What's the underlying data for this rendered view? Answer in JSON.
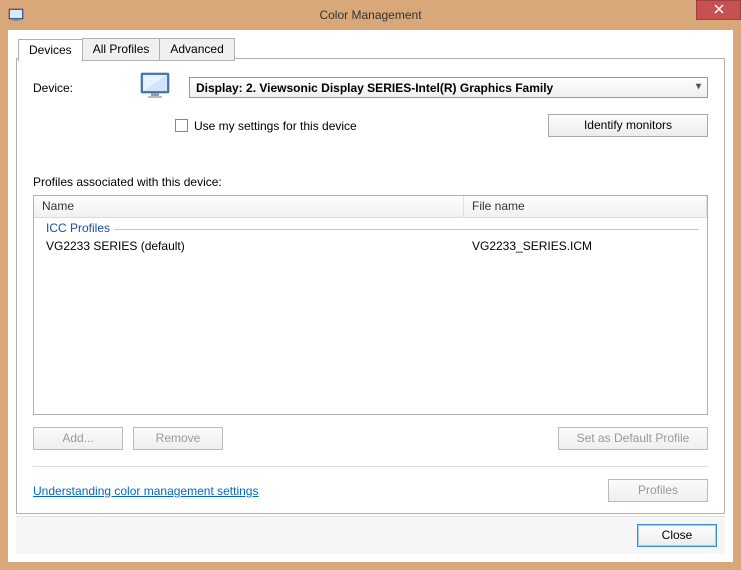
{
  "window": {
    "title": "Color Management"
  },
  "tabs": [
    {
      "label": "Devices",
      "active": true
    },
    {
      "label": "All Profiles",
      "active": false
    },
    {
      "label": "Advanced",
      "active": false
    }
  ],
  "device": {
    "label": "Device:",
    "selected": "Display: 2. Viewsonic Display SERIES-Intel(R) Graphics Family"
  },
  "use_my_settings": {
    "label": "Use my settings for this device",
    "checked": false
  },
  "identify_btn": "Identify monitors",
  "profiles_section_label": "Profiles associated with this device:",
  "list": {
    "columns": {
      "name": "Name",
      "file": "File name"
    },
    "group": "ICC Profiles",
    "rows": [
      {
        "name": "VG2233 SERIES (default)",
        "file": "VG2233_SERIES.ICM"
      }
    ]
  },
  "buttons": {
    "add": "Add...",
    "remove": "Remove",
    "set_default": "Set as Default Profile",
    "profiles": "Profiles",
    "close": "Close"
  },
  "link_text": "Understanding color management settings"
}
